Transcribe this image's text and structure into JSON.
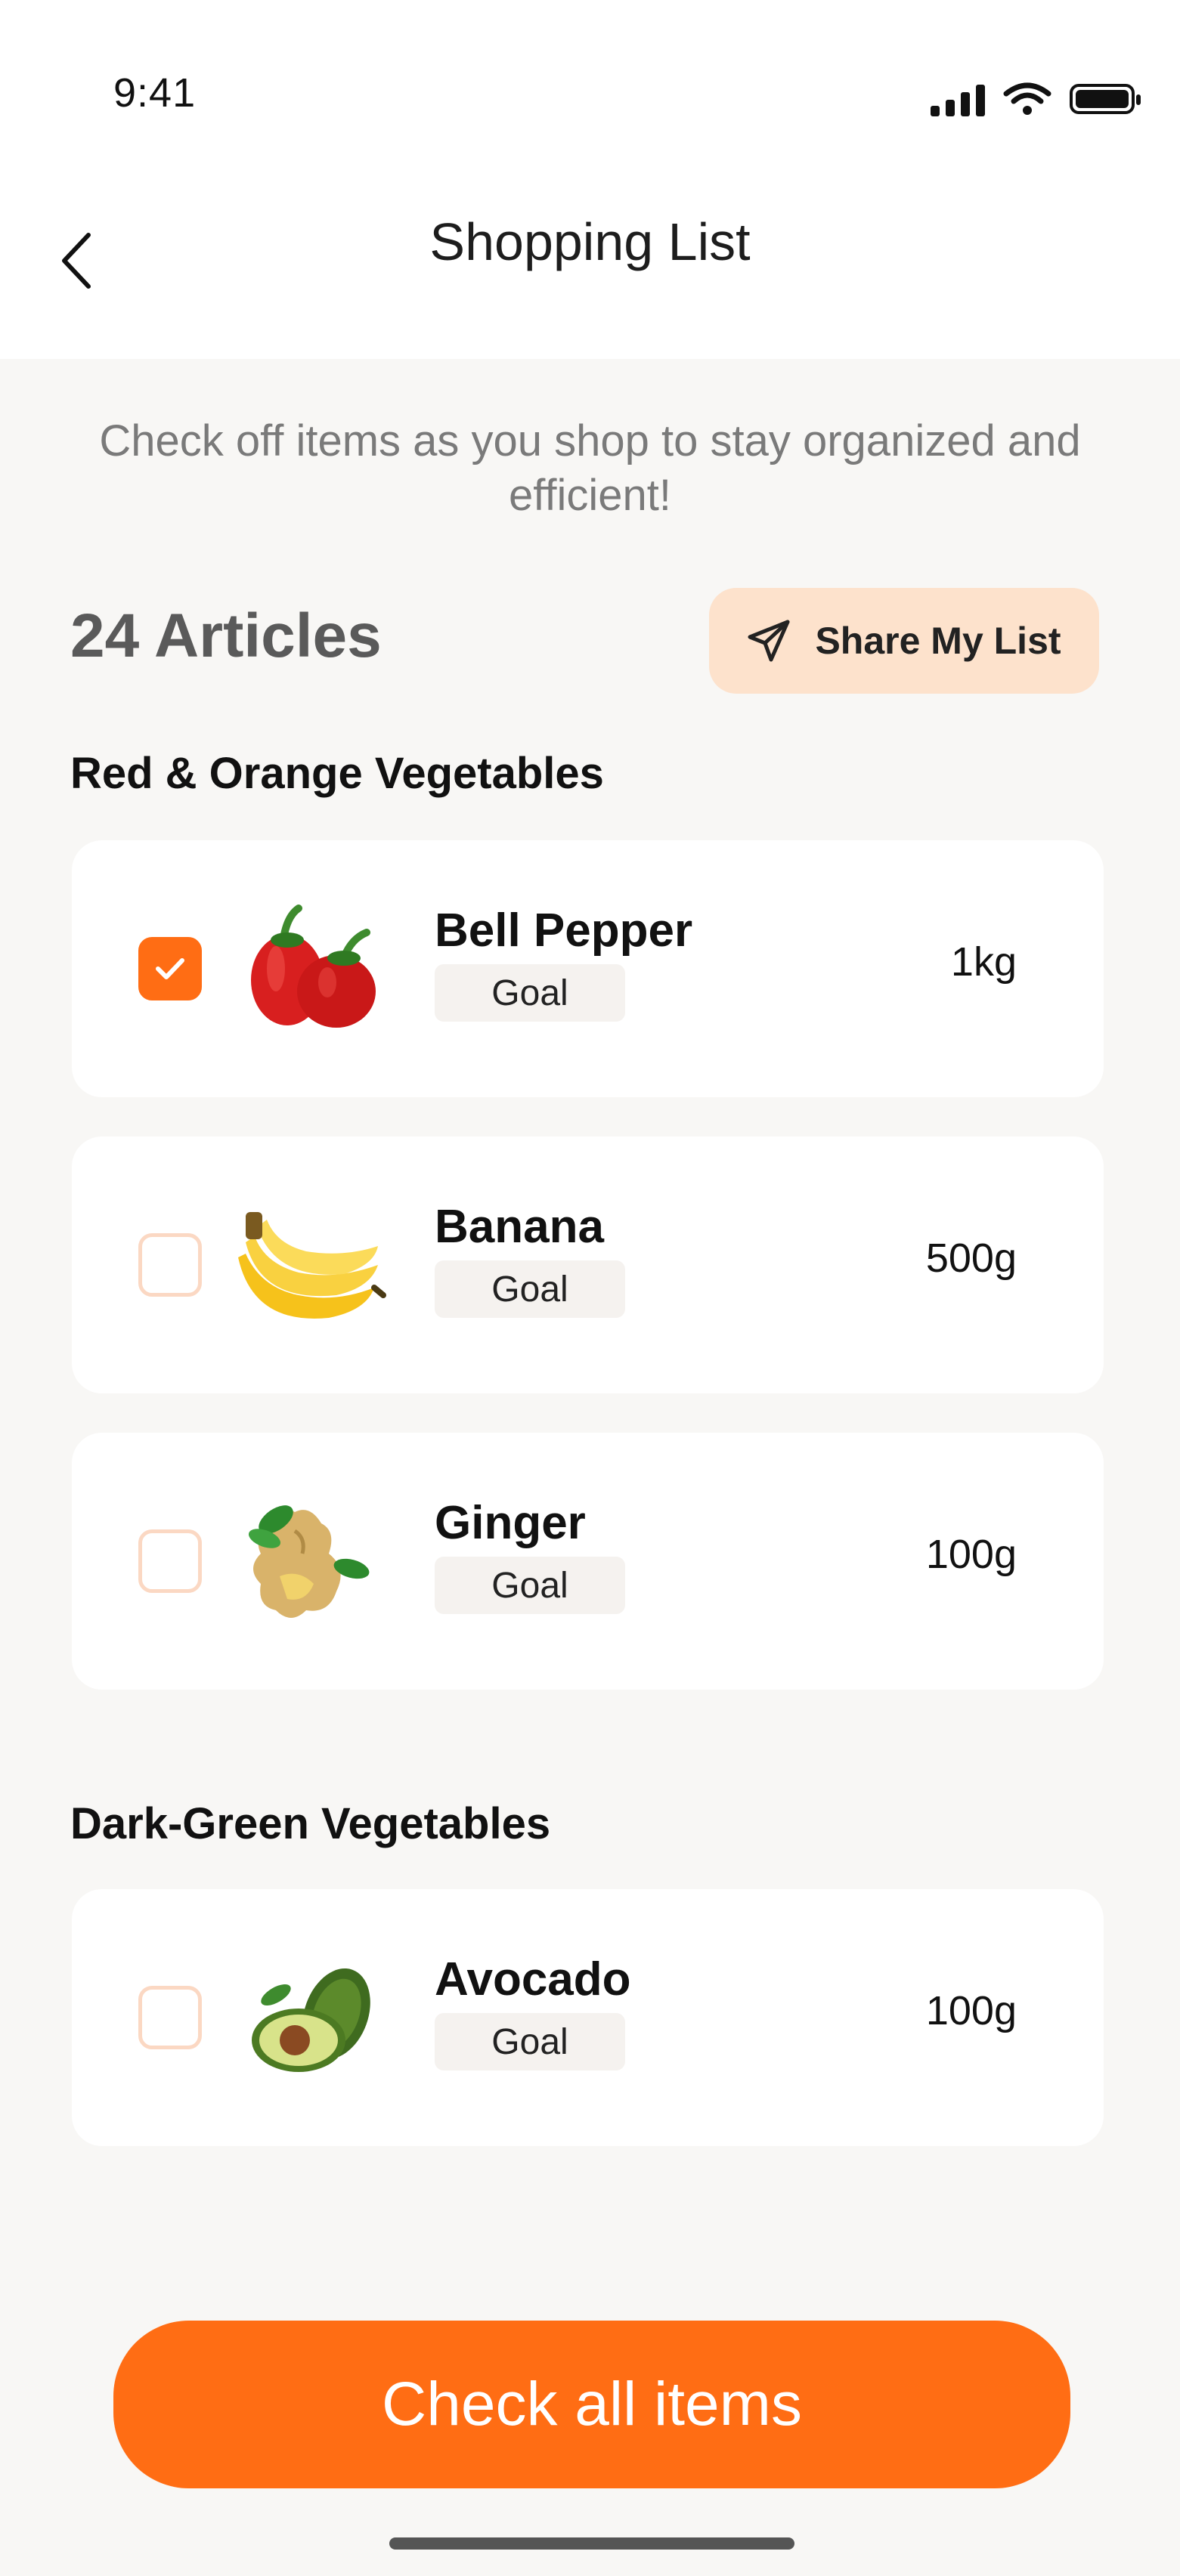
{
  "status_bar": {
    "time": "9:41"
  },
  "header": {
    "title": "Shopping List"
  },
  "subtitle": "Check off items as you shop to stay organized and efficient!",
  "summary": {
    "articles_count": "24 Articles",
    "share_label": "Share My List"
  },
  "sections": [
    {
      "title": "Red & Orange Vegetables",
      "items": [
        {
          "name": "Bell Pepper",
          "badge": "Goal",
          "quantity": "1kg",
          "checked": true
        },
        {
          "name": "Banana",
          "badge": "Goal",
          "quantity": "500g",
          "checked": false
        },
        {
          "name": "Ginger",
          "badge": "Goal",
          "quantity": "100g",
          "checked": false
        }
      ]
    },
    {
      "title": "Dark-Green Vegetables",
      "items": [
        {
          "name": "Avocado",
          "badge": "Goal",
          "quantity": "100g",
          "checked": false
        }
      ]
    }
  ],
  "cta": {
    "label": "Check all items"
  },
  "colors": {
    "accent": "#FF6D14",
    "share_bg": "#FDE2CC",
    "background": "#F8F7F5",
    "checkbox_border": "#FBD8C3"
  }
}
